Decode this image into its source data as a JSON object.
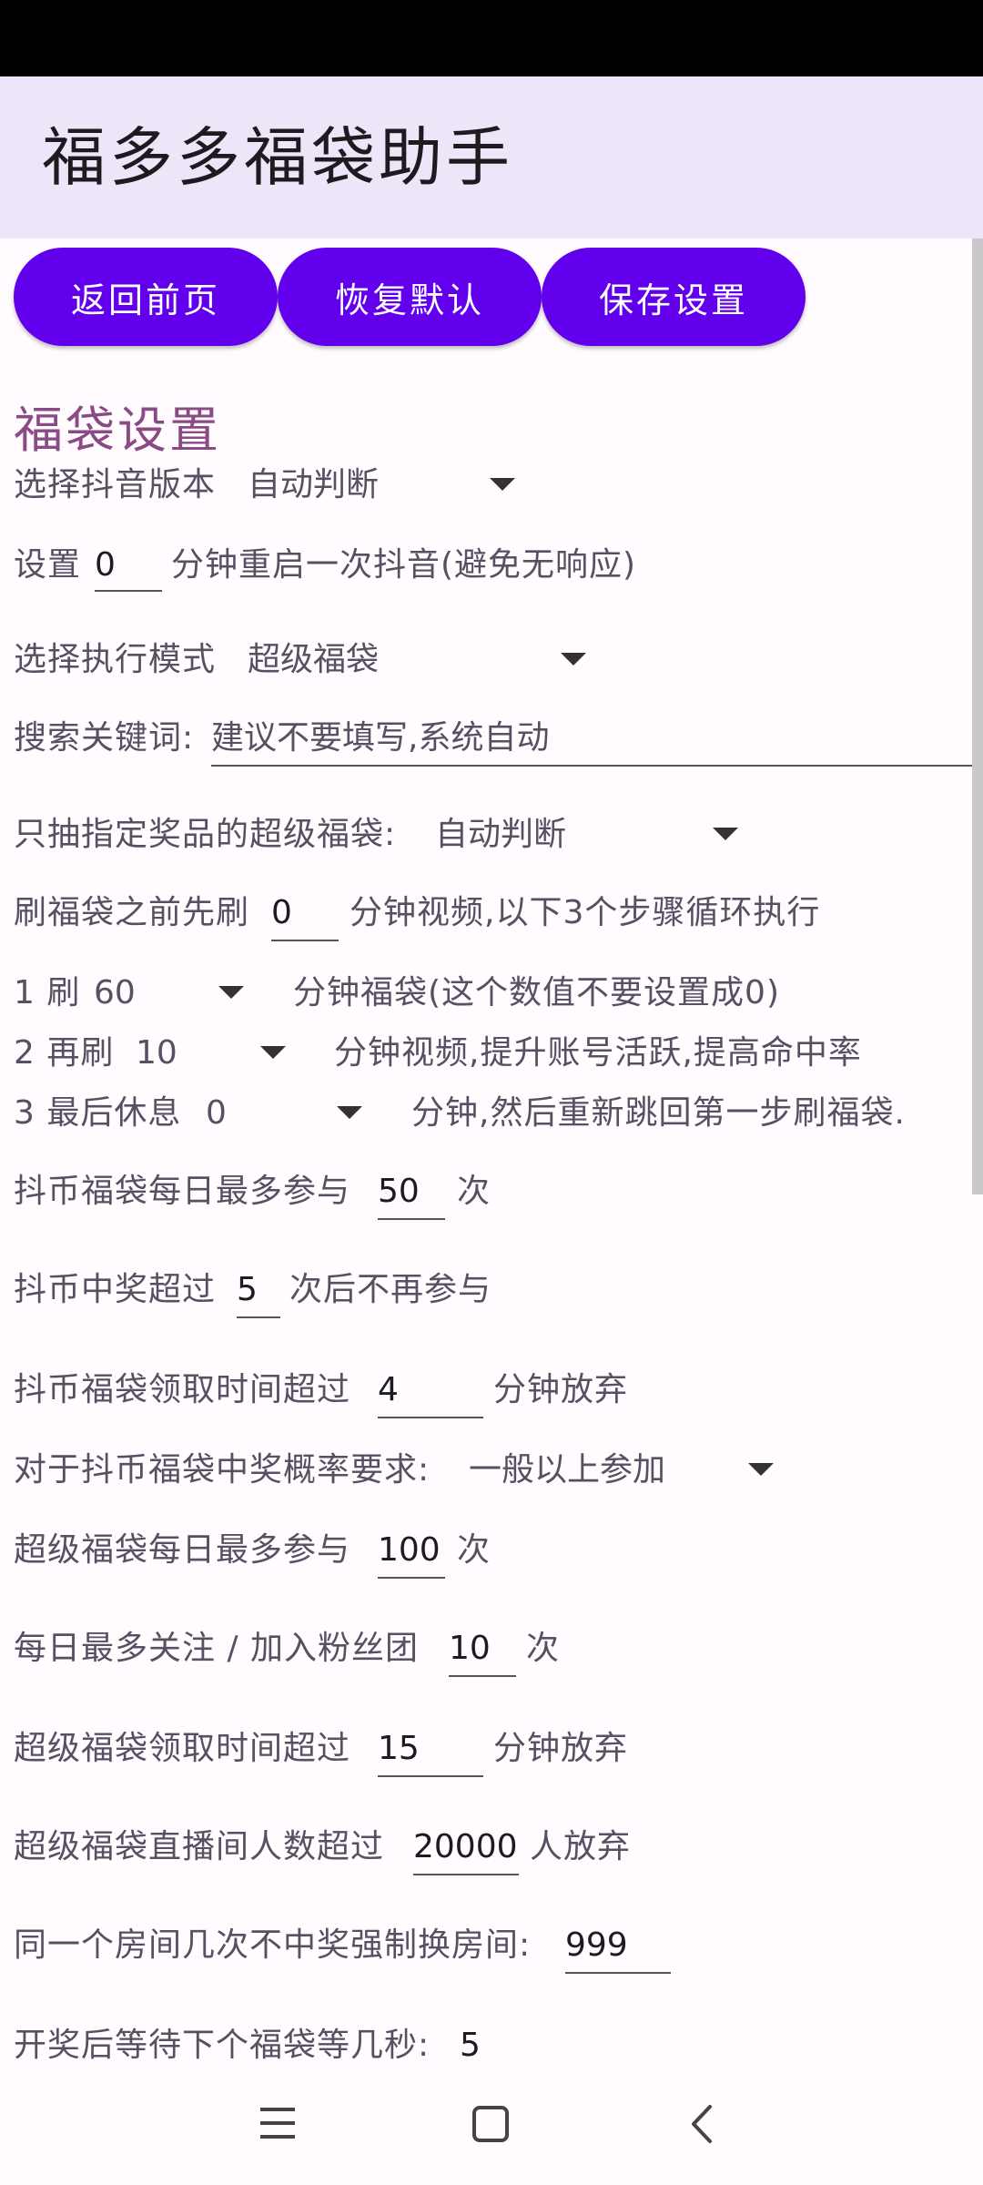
{
  "app": {
    "title": "福多多福袋助手"
  },
  "buttons": {
    "back": "返回前页",
    "reset": "恢复默认",
    "save": "保存设置"
  },
  "section_title": "福袋设置",
  "douyin_version": {
    "label": "选择抖音版本",
    "value": "自动判断"
  },
  "restart": {
    "prefix": "设置",
    "value": "0",
    "suffix": "分钟重启一次抖音(避免无响应)"
  },
  "exec_mode": {
    "label": "选择执行模式",
    "value": "超级福袋"
  },
  "search_keyword": {
    "label": "搜索关键词:",
    "value": "建议不要填写,系统自动"
  },
  "specified_prize": {
    "label": "只抽指定奖品的超级福袋:",
    "value": "自动判断"
  },
  "pre_video": {
    "prefix": "刷福袋之前先刷",
    "value": "0",
    "suffix": "分钟视频,以下3个步骤循环执行"
  },
  "step1": {
    "prefix": "1 刷",
    "value": "60",
    "suffix": "分钟福袋(这个数值不要设置成0)"
  },
  "step2": {
    "prefix": "2 再刷",
    "value": "10",
    "suffix": "分钟视频,提升账号活跃,提高命中率"
  },
  "step3": {
    "prefix": "3 最后休息",
    "value": "0",
    "suffix": "分钟,然后重新跳回第一步刷福袋."
  },
  "coin_daily": {
    "prefix": "抖币福袋每日最多参与",
    "value": "50",
    "suffix": "次"
  },
  "coin_win": {
    "prefix": "抖币中奖超过",
    "value": "5",
    "suffix": "次后不再参与"
  },
  "coin_time": {
    "prefix": "抖币福袋领取时间超过",
    "value": "4",
    "suffix": "分钟放弃"
  },
  "coin_prob": {
    "label": "对于抖币福袋中奖概率要求:",
    "value": "一般以上参加"
  },
  "super_daily": {
    "prefix": "超级福袋每日最多参与",
    "value": "100",
    "suffix": "次"
  },
  "follow_daily": {
    "prefix": "每日最多关注 / 加入粉丝团",
    "value": "10",
    "suffix": "次"
  },
  "super_time": {
    "prefix": "超级福袋领取时间超过",
    "value": "15",
    "suffix": "分钟放弃"
  },
  "super_people": {
    "prefix": "超级福袋直播间人数超过",
    "value": "20000",
    "suffix": "人放弃"
  },
  "room_switch": {
    "prefix": "同一个房间几次不中奖强制换房间:",
    "value": "999"
  },
  "wait_next": {
    "prefix": "开奖后等待下个福袋等几秒:",
    "value": "5"
  },
  "nav": {
    "menu_icon": "menu-icon",
    "home_icon": "home-square-icon",
    "back_icon": "back-chevron-icon"
  },
  "colors": {
    "accent": "#6200ee",
    "app_bar": "#eee5f8",
    "section_title": "#8a4a85"
  }
}
